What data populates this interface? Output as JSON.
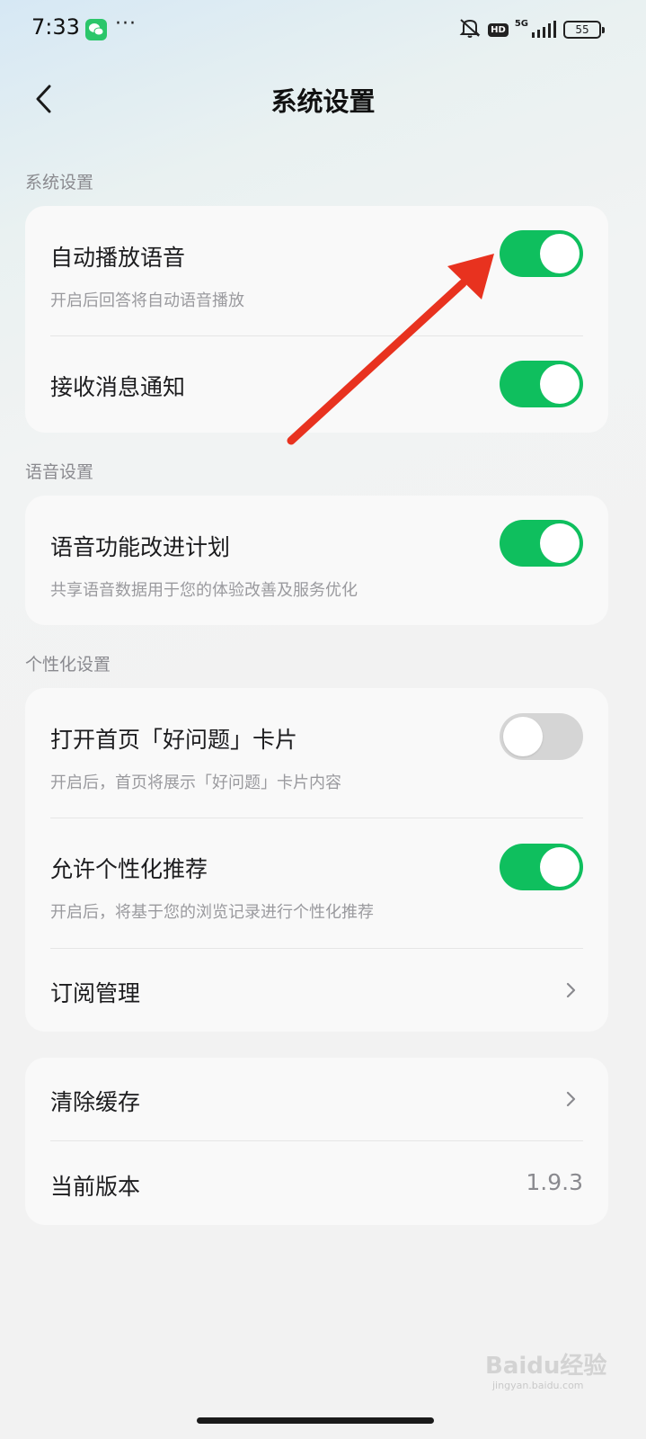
{
  "status_bar": {
    "time": "7:33",
    "more": "···",
    "network_badge": "HD",
    "network_type": "5G",
    "battery": "55"
  },
  "header": {
    "title": "系统设置"
  },
  "sections": {
    "system": {
      "label": "系统设置",
      "auto_voice": {
        "title": "自动播放语音",
        "subtitle": "开启后回答将自动语音播放",
        "enabled": true
      },
      "notify": {
        "title": "接收消息通知",
        "enabled": true
      }
    },
    "voice": {
      "label": "语音设置",
      "improve": {
        "title": "语音功能改进计划",
        "subtitle": "共享语音数据用于您的体验改善及服务优化",
        "enabled": true
      }
    },
    "personal": {
      "label": "个性化设置",
      "good_question": {
        "title": "打开首页「好问题」卡片",
        "subtitle": "开启后，首页将展示「好问题」卡片内容",
        "enabled": false
      },
      "recommend": {
        "title": "允许个性化推荐",
        "subtitle": "开启后，将基于您的浏览记录进行个性化推荐",
        "enabled": true
      },
      "subscribe": {
        "title": "订阅管理"
      }
    },
    "other": {
      "clear_cache": {
        "title": "清除缓存"
      },
      "version": {
        "title": "当前版本",
        "value": "1.9.3"
      }
    }
  },
  "watermark": {
    "text": "Baidu经验",
    "sub": "jingyan.baidu.com"
  },
  "colors": {
    "toggle_on": "#0fbf5e",
    "toggle_off": "#d5d5d5",
    "annotation_arrow": "#e8321f"
  }
}
